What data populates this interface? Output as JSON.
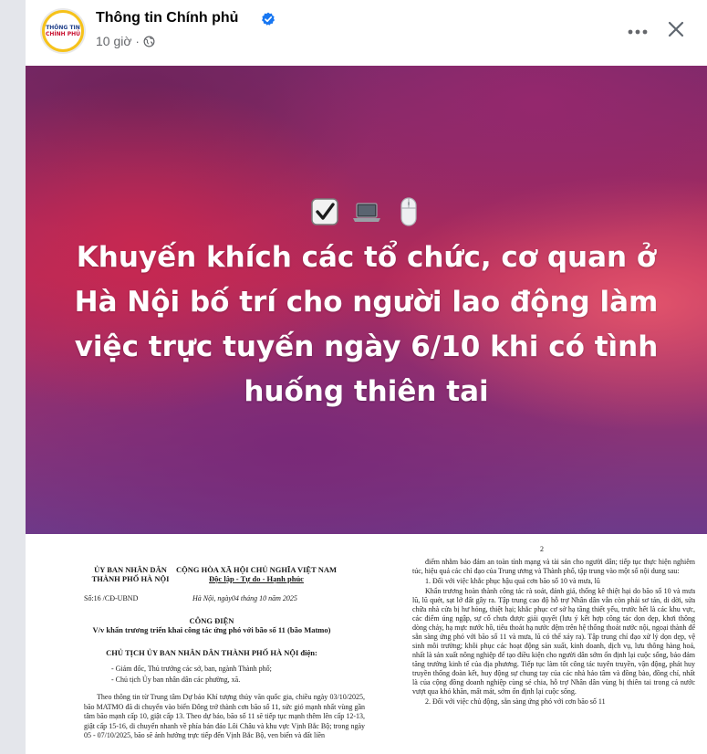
{
  "post": {
    "page_name": "Thông tin Chính phủ",
    "time": "10 giờ",
    "avatar_text_top": "THÔNG TIN",
    "avatar_text_bottom": "CHÍNH PHỦ",
    "verified_color": "#1877f2"
  },
  "header_icons": {
    "more": "more-horizontal-icon",
    "close": "close-icon",
    "audience": "globe-icon",
    "verified": "verified-badge-icon"
  },
  "cover": {
    "icons": [
      "check-box-icon",
      "laptop-icon",
      "computer-mouse-icon"
    ],
    "title": "Khuyến khích các tổ chức, cơ quan ở Hà Nội bố trí cho người lao động làm việc trực tuyến ngày 6/10 khi có tình huống thiên tai"
  },
  "document": {
    "org_left_1": "ỦY BAN NHÂN DÂN",
    "org_left_2": "THÀNH PHỐ HÀ NỘI",
    "org_right_1": "CỘNG HÒA XÃ HỘI CHỦ NGHĨA VIỆT NAM",
    "org_right_2": "Độc lập - Tự do - Hạnh phúc",
    "number": "Số:16 /CĐ-UBND",
    "date": "Hà Nội, ngày04 tháng 10 năm 2025",
    "doc_type": "CÔNG ĐIỆN",
    "subject": "V/v khẩn trương triển khai công tác ứng phó với bão số 11 (bão Matmo)",
    "sender": "CHỦ TỊCH ỦY BAN NHÂN DÂN THÀNH PHỐ HÀ NỘI điện:",
    "recipient_1": "- Giám đốc, Thủ trưởng các sở, ban, ngành Thành phố;",
    "recipient_2": "- Chủ tịch Ủy ban nhân dân các phường, xã.",
    "body_left": "Theo thông tin từ Trung tâm Dự báo Khí tượng thủy văn quốc gia, chiều ngày 03/10/2025, bão MATMO đã di chuyển vào biển Đông trở thành cơn bão số 11, sức gió mạnh nhất vùng gần tâm bão mạnh cấp 10, giật cấp 13. Theo dự báo, bão số 11 sẽ tiếp tục mạnh thêm lên cấp 12-13, giật cấp 15-16, di chuyển nhanh về phía bán đảo Lôi Châu và khu vực Vịnh Bắc Bộ; trong ngày 05 - 07/10/2025, bão sẽ ảnh hưởng trực tiếp đến Vịnh Bắc Bộ, ven biển và đất liền",
    "page_number": "2",
    "body_right_1": "điểm nhằm bảo đảm an toàn tính mạng và tài sản cho người dân; tiếp tục thực hiện nghiêm túc, hiệu quả các chỉ đạo của Trung ương và Thành phố, tập trung vào một số nội dung sau:",
    "body_right_2": "1. Đối với việc khắc phục hậu quả cơn bão số 10 và mưa, lũ",
    "body_right_3": "Khẩn trương hoàn thành công tác rà soát, đánh giá, thống kê thiệt hại do bão số 10 và mưa lũ, lũ quét, sạt lở đất gây ra. Tập trung cao độ hỗ trợ Nhân dân vẫn còn phải sơ tán, di dời, sửa chữa nhà cửa bị hư hỏng, thiệt hại; khắc phục cơ sở hạ tầng thiết yếu, trước hết là các khu vực, các điểm úng ngập, sự cố chưa được giải quyết (lưu ý kết hợp công tác dọn dẹp, khơi thông dòng chảy, hạ mực nước hồ, tiêu thoát hạ nước đệm trên hệ thống thoát nước nội, ngoại thành để sẵn sàng ứng phó với bão số 11 và mưa, lũ có thể xảy ra). Tập trung chỉ đạo xử lý dọn dẹp, vệ sinh môi trường; khôi phục các hoạt động sản xuất, kinh doanh, dịch vụ, lưu thông hàng hoá, nhất là sản xuất nông nghiệp để tạo điều kiện cho người dân sớm ổn định lại cuộc sống, bảo đảm tăng trưởng kinh tế của địa phương. Tiếp tục làm tốt công tác tuyên truyền, vận động, phát huy truyền thống đoàn kết, huy động sự chung tay của các nhà hảo tâm và đồng bào, đồng chí, nhất là của cộng đồng doanh nghiệp cùng sẻ chia, hỗ trợ Nhân dân vùng bị thiên tai trong cả nước vượt qua khó khăn, mất mát, sớm ổn định lại cuộc sống.",
    "body_right_4": "2. Đối với việc chủ động, sẵn sàng ứng phó với cơn bão số 11"
  }
}
